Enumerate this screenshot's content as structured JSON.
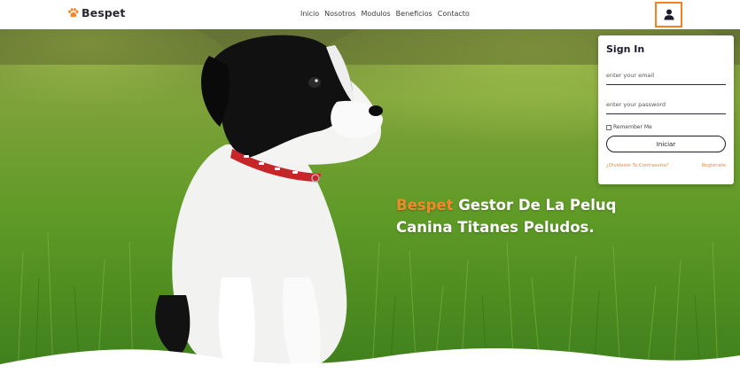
{
  "header": {
    "brand": "Bespet",
    "nav": [
      "Inicio",
      "Nosotros",
      "Modulos",
      "Beneficios",
      "Contacto"
    ]
  },
  "hero": {
    "title_accent": "Bespet",
    "title_rest": " Gestor De La Peluq",
    "title_line2": "Canina Titanes Peludos."
  },
  "signin": {
    "title": "Sign In",
    "email_placeholder": "enter your email",
    "password_placeholder": "enter your password",
    "remember_label": "Remember Me",
    "submit_label": "Iniciar",
    "forgot_label": "¿Olvidaste Tu Contraseña?",
    "register_label": "Registrate"
  },
  "colors": {
    "accent": "#f5882b",
    "dark": "#1d1b2e"
  },
  "icons": [
    "paw-icon",
    "user-icon"
  ]
}
